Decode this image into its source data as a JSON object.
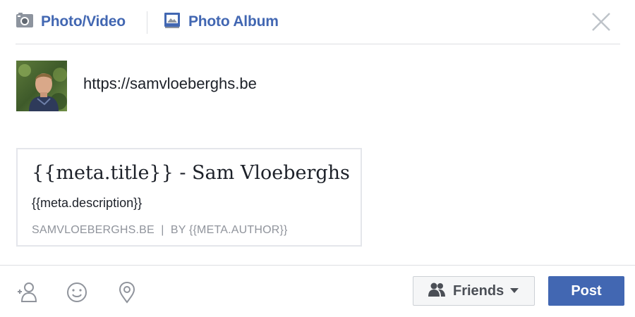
{
  "header": {
    "tabs": [
      {
        "label": "Photo/Video",
        "icon": "camera-icon"
      },
      {
        "label": "Photo Album",
        "icon": "photo-album-icon"
      }
    ],
    "close_icon": "close-icon"
  },
  "composer": {
    "text": "https://samvloeberghs.be",
    "avatar_icon": "profile-photo"
  },
  "link_preview": {
    "title": "{{meta.title}} - Sam Vloeberghs",
    "description": "{{meta.description}}",
    "meta_line": "SAMVLOEBERGHS.BE  |  BY {{META.AUTHOR}}"
  },
  "footer": {
    "tools": [
      {
        "icon": "tag-friends-icon"
      },
      {
        "icon": "feeling-emoji-icon"
      },
      {
        "icon": "check-in-location-icon"
      }
    ],
    "audience_label": "Friends",
    "post_label": "Post"
  },
  "colors": {
    "brand_blue": "#4267b2",
    "border": "#dddfe2",
    "muted_text": "#90949c"
  }
}
